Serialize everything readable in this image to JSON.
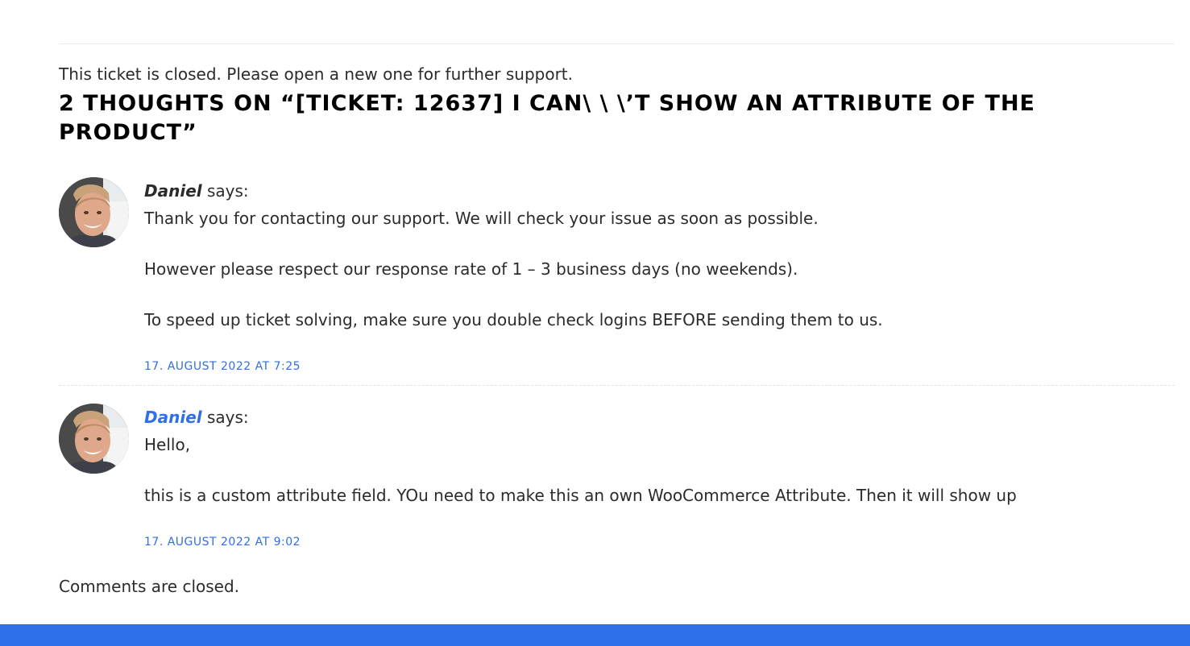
{
  "notice": "This ticket is closed. Please open a new one for further support.",
  "comments_title": "2 thoughts on “[Ticket: 12637] I can\\ \\ \\’t show an attribute of the product”",
  "comments": [
    {
      "author": "Daniel",
      "says": " says:",
      "author_is_link": false,
      "avatar_icon": "author-avatar",
      "paragraphs": [
        "Thank you for contacting our support. We will check your issue as soon as possible.",
        "However please respect our response rate of 1 – 3 business days (no weekends).",
        "To speed up ticket solving, make sure you double check logins BEFORE sending them to us."
      ],
      "date": "17. August 2022 at 7:25"
    },
    {
      "author": "Daniel",
      "says": " says:",
      "author_is_link": true,
      "avatar_icon": "author-avatar",
      "paragraphs": [
        "Hello,",
        "this is a custom attribute field. YOu need to make this an own WooCommerce Attribute. Then it will show up"
      ],
      "date": "17. August 2022 at 9:02"
    }
  ],
  "comments_closed": "Comments are closed.",
  "colors": {
    "accent": "#2f6fe8",
    "text": "#2b2b2b",
    "heading": "#000000"
  }
}
